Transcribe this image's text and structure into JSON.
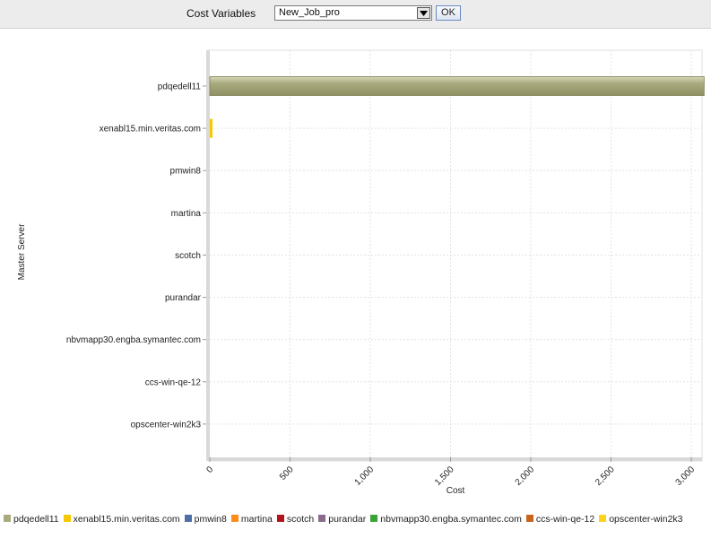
{
  "toolbar": {
    "label": "Cost Variables",
    "selected": "New_Job_pro",
    "ok_label": "OK"
  },
  "chart_data": {
    "type": "bar",
    "orientation": "horizontal",
    "xlabel": "Cost",
    "ylabel": "Master Server",
    "xlim": [
      0,
      3000
    ],
    "xticks": [
      "0",
      "500",
      "1,000",
      "1,500",
      "2,000",
      "2,500",
      "3,000"
    ],
    "grid": true,
    "legend_position": "bottom",
    "categories": [
      "pdqedell11",
      "xenabl15.min.veritas.com",
      "pmwin8",
      "martina",
      "scotch",
      "purandar",
      "nbvmapp30.engba.symantec.com",
      "ccs-win-qe-12",
      "opscenter-win2k3"
    ],
    "values": [
      3080,
      12,
      0,
      0,
      0,
      0,
      0,
      0,
      0
    ],
    "colors": [
      "#a9ab7f",
      "#f5c800",
      "#4e6fa6",
      "#ff8c1a",
      "#b3141a",
      "#8c6a8c",
      "#3aa33a",
      "#c8641e",
      "#ffd21a"
    ]
  }
}
